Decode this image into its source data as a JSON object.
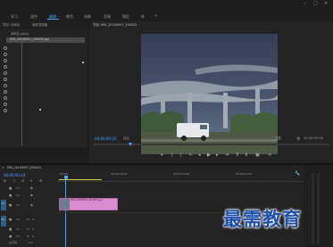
{
  "menu": {
    "items": [
      "学习",
      "组件",
      "编辑",
      "颜色",
      "效果",
      "音频",
      "图形",
      "库"
    ],
    "active_index": 2,
    "overflow": "»"
  },
  "window_controls": {
    "minimize": "–",
    "maximize": "□",
    "close": "✕"
  },
  "project_panel": {
    "tabs": [
      "项目: 未命名",
      "媒体浏览器"
    ],
    "file_name": "IMG_20190907_204025.jpg",
    "bin_label": "未命名.prproj"
  },
  "program_monitor": {
    "title": "节目: IMG_20190907_204025",
    "timecode_left": "00;00;00;10",
    "fit_label": "适合",
    "quality_label": "完整",
    "timecode_right": "00;00;05;00"
  },
  "timeline": {
    "tab_title": "IMG_20190907_204025",
    "timecode": "00;00;00;10",
    "ruler_labels": [
      ":00:00",
      "00:00:05:00",
      "00:00:10:00",
      "00:00:15:00"
    ],
    "track_labels": [
      "V3",
      "V2",
      "V1",
      "A1",
      "A2",
      "A3"
    ],
    "source_patch": [
      "V1",
      "A1"
    ],
    "clip_label": "IMG_20190907_204025.jpg",
    "master_label": "主声道",
    "master_value": "0.0"
  },
  "colors": {
    "accent": "#4aa3ff",
    "clip": "#d98ccf",
    "playhead": "#4aa3ff"
  },
  "watermark": "最需教育"
}
